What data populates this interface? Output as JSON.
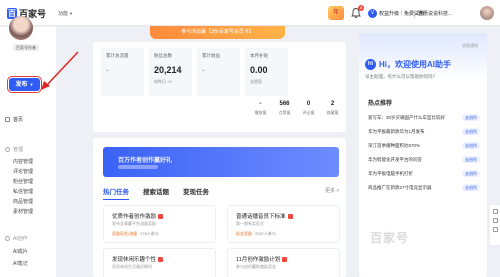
{
  "topbar": {
    "logo_mark": "百",
    "logo_text": "百家号",
    "version": "功能",
    "promo_flag": "年",
    "bell_badge": "8",
    "trial_crown": "V",
    "trial_label": "权益升级｜免费试用",
    "user_name": "惠惠说说科技..."
  },
  "event_banner": "参与活动赢【3份百家号会员卡】",
  "sidebar": {
    "avatar_tag": "百家号作者",
    "publish_label": "发布",
    "home_label": "首页",
    "manage_group": "管理",
    "manage_items": [
      "内容管理",
      "评论管理",
      "粉丝管理",
      "私信管理",
      "商品管理",
      "素材管理"
    ],
    "create_group": "AI创作",
    "create_items": [
      "AI成片",
      "AI笔记"
    ]
  },
  "stats": [
    {
      "label": "累计总流量",
      "value": "-",
      "sub": "",
      "muted": true
    },
    {
      "label": "粉丝总数",
      "value": "20,214",
      "sub": "较昨日 +0",
      "muted": false
    },
    {
      "label": "累计收益",
      "value": "-",
      "sub": "",
      "muted": true
    },
    {
      "label": "本月补贴",
      "value": "0.00",
      "sub": "去提现",
      "muted": false
    }
  ],
  "mini_stats": [
    {
      "value": "-",
      "label": "播放量"
    },
    {
      "value": "566",
      "label": "点赞量"
    },
    {
      "value": "0",
      "label": "评论量"
    },
    {
      "value": "2",
      "label": "收藏量"
    }
  ],
  "task_banner": "百万作者创作赢好礼",
  "tabs": [
    "热门任务",
    "搜索话题",
    "变现任务"
  ],
  "more_label": "更多 >",
  "tasks": [
    {
      "title": "优质作者创作激励",
      "desc": "发布文章赢平台流量奖励",
      "reward": "奖励现金/流量",
      "count": "278人参与",
      "thumb_color": "#f7c46c"
    },
    {
      "title": "普通话播音员下标准",
      "desc": "第一期有奖征文",
      "reward": "现金奖励",
      "count": "2257人参与",
      "thumb_color": "#9bc3ff"
    },
    {
      "title": "发现休闲乐趣个性",
      "desc": "发现休闲生活美好瞬间",
      "reward": "",
      "count": "",
      "thumb_color": "#ffd59b"
    },
    {
      "title": "11月创作激励计划",
      "desc": "参与创作赢取激励奖金",
      "reward": "",
      "count": "",
      "thumb_color": "#c7d6ff"
    }
  ],
  "ai_panel": {
    "corner_text": "消息通知",
    "logo": "Hi",
    "title": "Hi，欢迎使用AI助手",
    "subtitle": "号主助理，有什么可以帮助你的吗？",
    "hot_title": "热点推荐",
    "action_label": "去创作",
    "hot_items": [
      "爱写车：30岁买辆国产什么车型比较好",
      "华为平板最新款华为1月发布",
      "深汀首季播种面积达570%",
      "华为智能化开发平台的问答",
      "华为平板电脑手机打折",
      "商品推广在新款27寸电竞显示器"
    ]
  },
  "watermark": "百家号"
}
